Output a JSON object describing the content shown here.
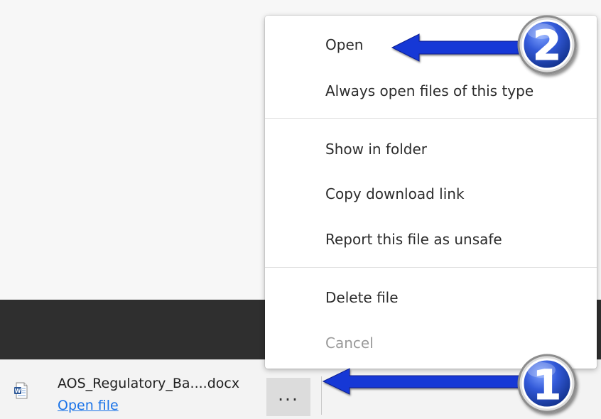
{
  "download_bar": {
    "file_name": "AOS_Regulatory_Ba....docx",
    "open_link": "Open file",
    "more_button": "...",
    "file_icon": "word-document-icon"
  },
  "context_menu": {
    "items": [
      {
        "label": "Open",
        "enabled": true
      },
      {
        "label": "Always open files of this type",
        "enabled": true
      },
      {
        "label": "Show in folder",
        "enabled": true
      },
      {
        "label": "Copy download link",
        "enabled": true
      },
      {
        "label": "Report this file as unsafe",
        "enabled": true
      },
      {
        "label": "Delete file",
        "enabled": true
      },
      {
        "label": "Cancel",
        "enabled": false
      }
    ]
  },
  "callouts": [
    {
      "number": "1",
      "target": "more-button"
    },
    {
      "number": "2",
      "target": "menu-item-open"
    }
  ],
  "colors": {
    "arrow_blue": "#1238d6",
    "callout_blue": "#2449b8",
    "link_blue": "#1a73e8",
    "dark_band": "#2f2f2f"
  }
}
